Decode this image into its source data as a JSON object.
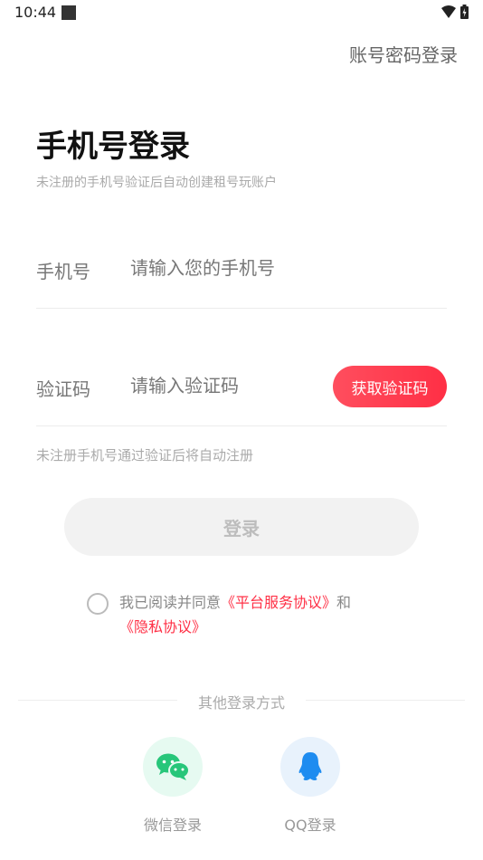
{
  "status_bar": {
    "time": "10:44"
  },
  "header": {
    "account_login_link": "账号密码登录"
  },
  "main": {
    "title": "手机号登录",
    "subtitle": "未注册的手机号验证后自动创建租号玩账户"
  },
  "form": {
    "phone": {
      "label": "手机号",
      "placeholder": "请输入您的手机号",
      "value": ""
    },
    "code": {
      "label": "验证码",
      "placeholder": "请输入验证码",
      "value": "",
      "get_code_label": "获取验证码"
    },
    "hint": "未注册手机号通过验证后将自动注册"
  },
  "login_button": {
    "label": "登录"
  },
  "agreement": {
    "checked": false,
    "prefix": "我已阅读并同意",
    "service_link": "《平台服务协议》",
    "conjunction": "和",
    "privacy_link": "《隐私协议》"
  },
  "other_login": {
    "label": "其他登录方式",
    "wechat": {
      "label": "微信登录",
      "icon": "wechat-icon"
    },
    "qq": {
      "label": "QQ登录",
      "icon": "qq-icon"
    }
  },
  "colors": {
    "accent": "#ff2f45",
    "wechat": "#27c67a",
    "qq": "#1e8cf0"
  }
}
